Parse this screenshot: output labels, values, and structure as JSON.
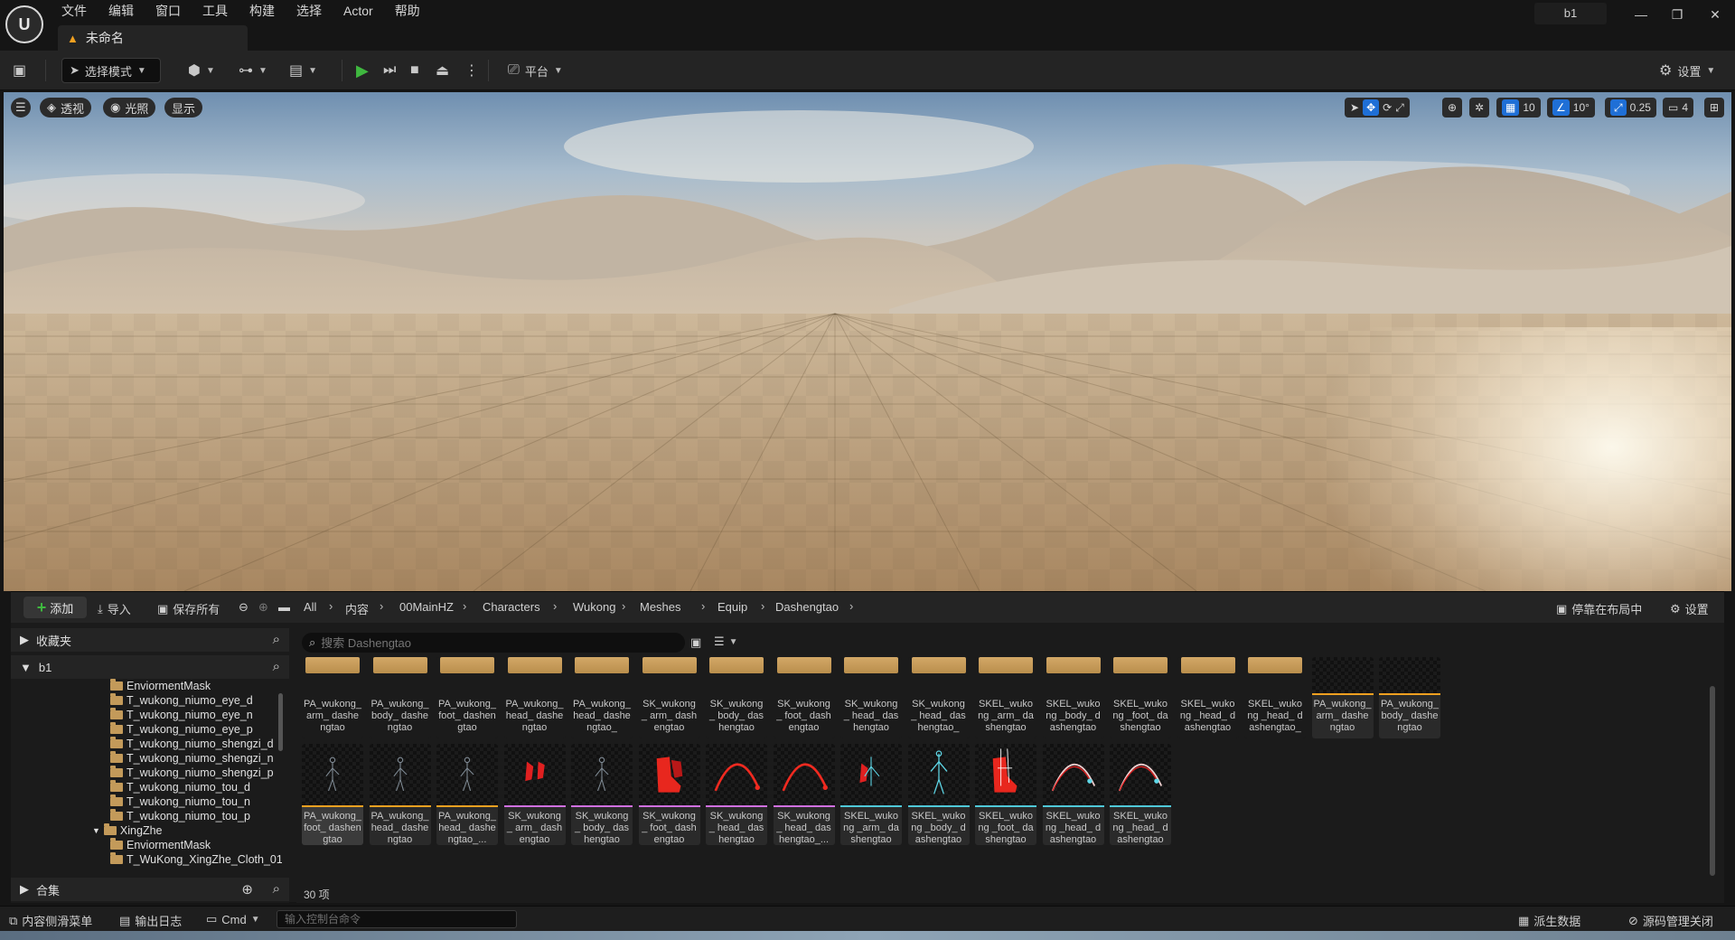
{
  "menu": {
    "items": [
      "文件",
      "编辑",
      "窗口",
      "工具",
      "构建",
      "选择",
      "Actor",
      "帮助"
    ]
  },
  "document_tab": {
    "name": "未命名"
  },
  "project_name": "b1",
  "window_controls": {
    "minimize": "—",
    "restore": "❐",
    "close": "✕"
  },
  "toolbar": {
    "mode_label": "选择模式",
    "platform_label": "平台",
    "settings_label": "设置"
  },
  "viewport": {
    "perspective_label": "透视",
    "lit_label": "光照",
    "show_label": "显示",
    "grid_snap": "10",
    "rotation_snap": "10°",
    "scale_snap": "0.25",
    "camera_speed": "4"
  },
  "content_browser": {
    "add_label": "添加",
    "import_label": "导入",
    "save_all_label": "保存所有",
    "breadcrumb": [
      "All",
      "内容",
      "00MainHZ",
      "Characters",
      "Wukong",
      "Meshes",
      "Equip",
      "Dashengtao"
    ],
    "dock_label": "停靠在布局中",
    "settings_label": "设置",
    "favorites_label": "收藏夹",
    "root_label": "b1",
    "collections_label": "合集",
    "search_placeholder": "搜索 Dashengtao",
    "item_count": "30 项",
    "tree": [
      "EnviormentMask",
      "T_wukong_niumo_eye_d",
      "T_wukong_niumo_eye_n",
      "T_wukong_niumo_eye_p",
      "T_wukong_niumo_shengzi_d",
      "T_wukong_niumo_shengzi_n",
      "T_wukong_niumo_shengzi_p",
      "T_wukong_niumo_tou_d",
      "T_wukong_niumo_tou_n",
      "T_wukong_niumo_tou_p",
      "XingZhe",
      "EnviormentMask",
      "T_WuKong_XingZhe_Cloth_01_"
    ],
    "assets_row1": [
      {
        "label": "PA_wukong_ arm_ dashengtao",
        "kind": "folder"
      },
      {
        "label": "PA_wukong_ body_ dashengtao",
        "kind": "folder"
      },
      {
        "label": "PA_wukong_ foot_ dashengtao",
        "kind": "folder"
      },
      {
        "label": "PA_wukong_ head_ dashengtao",
        "kind": "folder"
      },
      {
        "label": "PA_wukong_ head_ dashengtao_",
        "kind": "folder"
      },
      {
        "label": "SK_wukong_ arm_ dashengtao",
        "kind": "folder"
      },
      {
        "label": "SK_wukong_ body_ dashengtao",
        "kind": "folder"
      },
      {
        "label": "SK_wukong_ foot_ dashengtao",
        "kind": "folder"
      },
      {
        "label": "SK_wukong_ head_ dashengtao",
        "kind": "folder"
      },
      {
        "label": "SK_wukong_ head_ dashengtao_",
        "kind": "folder"
      },
      {
        "label": "SKEL_wukong _arm_ dashengtao",
        "kind": "folder"
      },
      {
        "label": "SKEL_wukong _body_ dashengtao",
        "kind": "folder"
      },
      {
        "label": "SKEL_wukong _foot_ dashengtao",
        "kind": "folder"
      },
      {
        "label": "SKEL_wukong _head_ dashengtao",
        "kind": "folder"
      },
      {
        "label": "SKEL_wukong _head_ dashengtao_",
        "kind": "folder"
      },
      {
        "label": "PA_wukong_ arm_ dashengtao",
        "kind": "dark"
      },
      {
        "label": "PA_wukong_ body_ dashengtao",
        "kind": "dark"
      }
    ],
    "assets_row2": [
      {
        "label": "PA_wukong_ foot_ dashengtao",
        "kind": "figure",
        "color": "#f0a020",
        "selected": true
      },
      {
        "label": "PA_wukong_ head_ dashengtao",
        "kind": "figure",
        "color": "#f0a020"
      },
      {
        "label": "PA_wukong_ head_ dashengtao_...",
        "kind": "figure",
        "color": "#f0a020"
      },
      {
        "label": "SK_wukong_ arm_ dashengtao",
        "kind": "red-arm",
        "color": "#d070e0"
      },
      {
        "label": "SK_wukong_ body_ dashengtao",
        "kind": "figure",
        "color": "#d070e0"
      },
      {
        "label": "SK_wukong_ foot_ dashengtao",
        "kind": "red-boot",
        "color": "#d070e0"
      },
      {
        "label": "SK_wukong_ head_ dashengtao",
        "kind": "red-arc",
        "color": "#d070e0"
      },
      {
        "label": "SK_wukong_ head_ dashengtao_...",
        "kind": "red-arc",
        "color": "#d070e0"
      },
      {
        "label": "SKEL_wukong _arm_ dashengtao",
        "kind": "skel-arm",
        "color": "#4fc8d8"
      },
      {
        "label": "SKEL_wukong _body_ dashengtao",
        "kind": "skel-body",
        "color": "#4fc8d8"
      },
      {
        "label": "SKEL_wukong _foot_ dashengtao",
        "kind": "skel-foot",
        "color": "#4fc8d8"
      },
      {
        "label": "SKEL_wukong _head_ dashengtao",
        "kind": "skel-arc",
        "color": "#4fc8d8"
      },
      {
        "label": "SKEL_wukong _head_ dashengtao_...",
        "kind": "skel-arc",
        "color": "#4fc8d8"
      }
    ]
  },
  "statusbar": {
    "content_drawer_label": "内容侧滑菜单",
    "output_log_label": "输出日志",
    "cmd_label": "Cmd",
    "console_placeholder": "输入控制台命令",
    "derived_data_label": "派生数据",
    "source_control_label": "源码管理关闭"
  }
}
